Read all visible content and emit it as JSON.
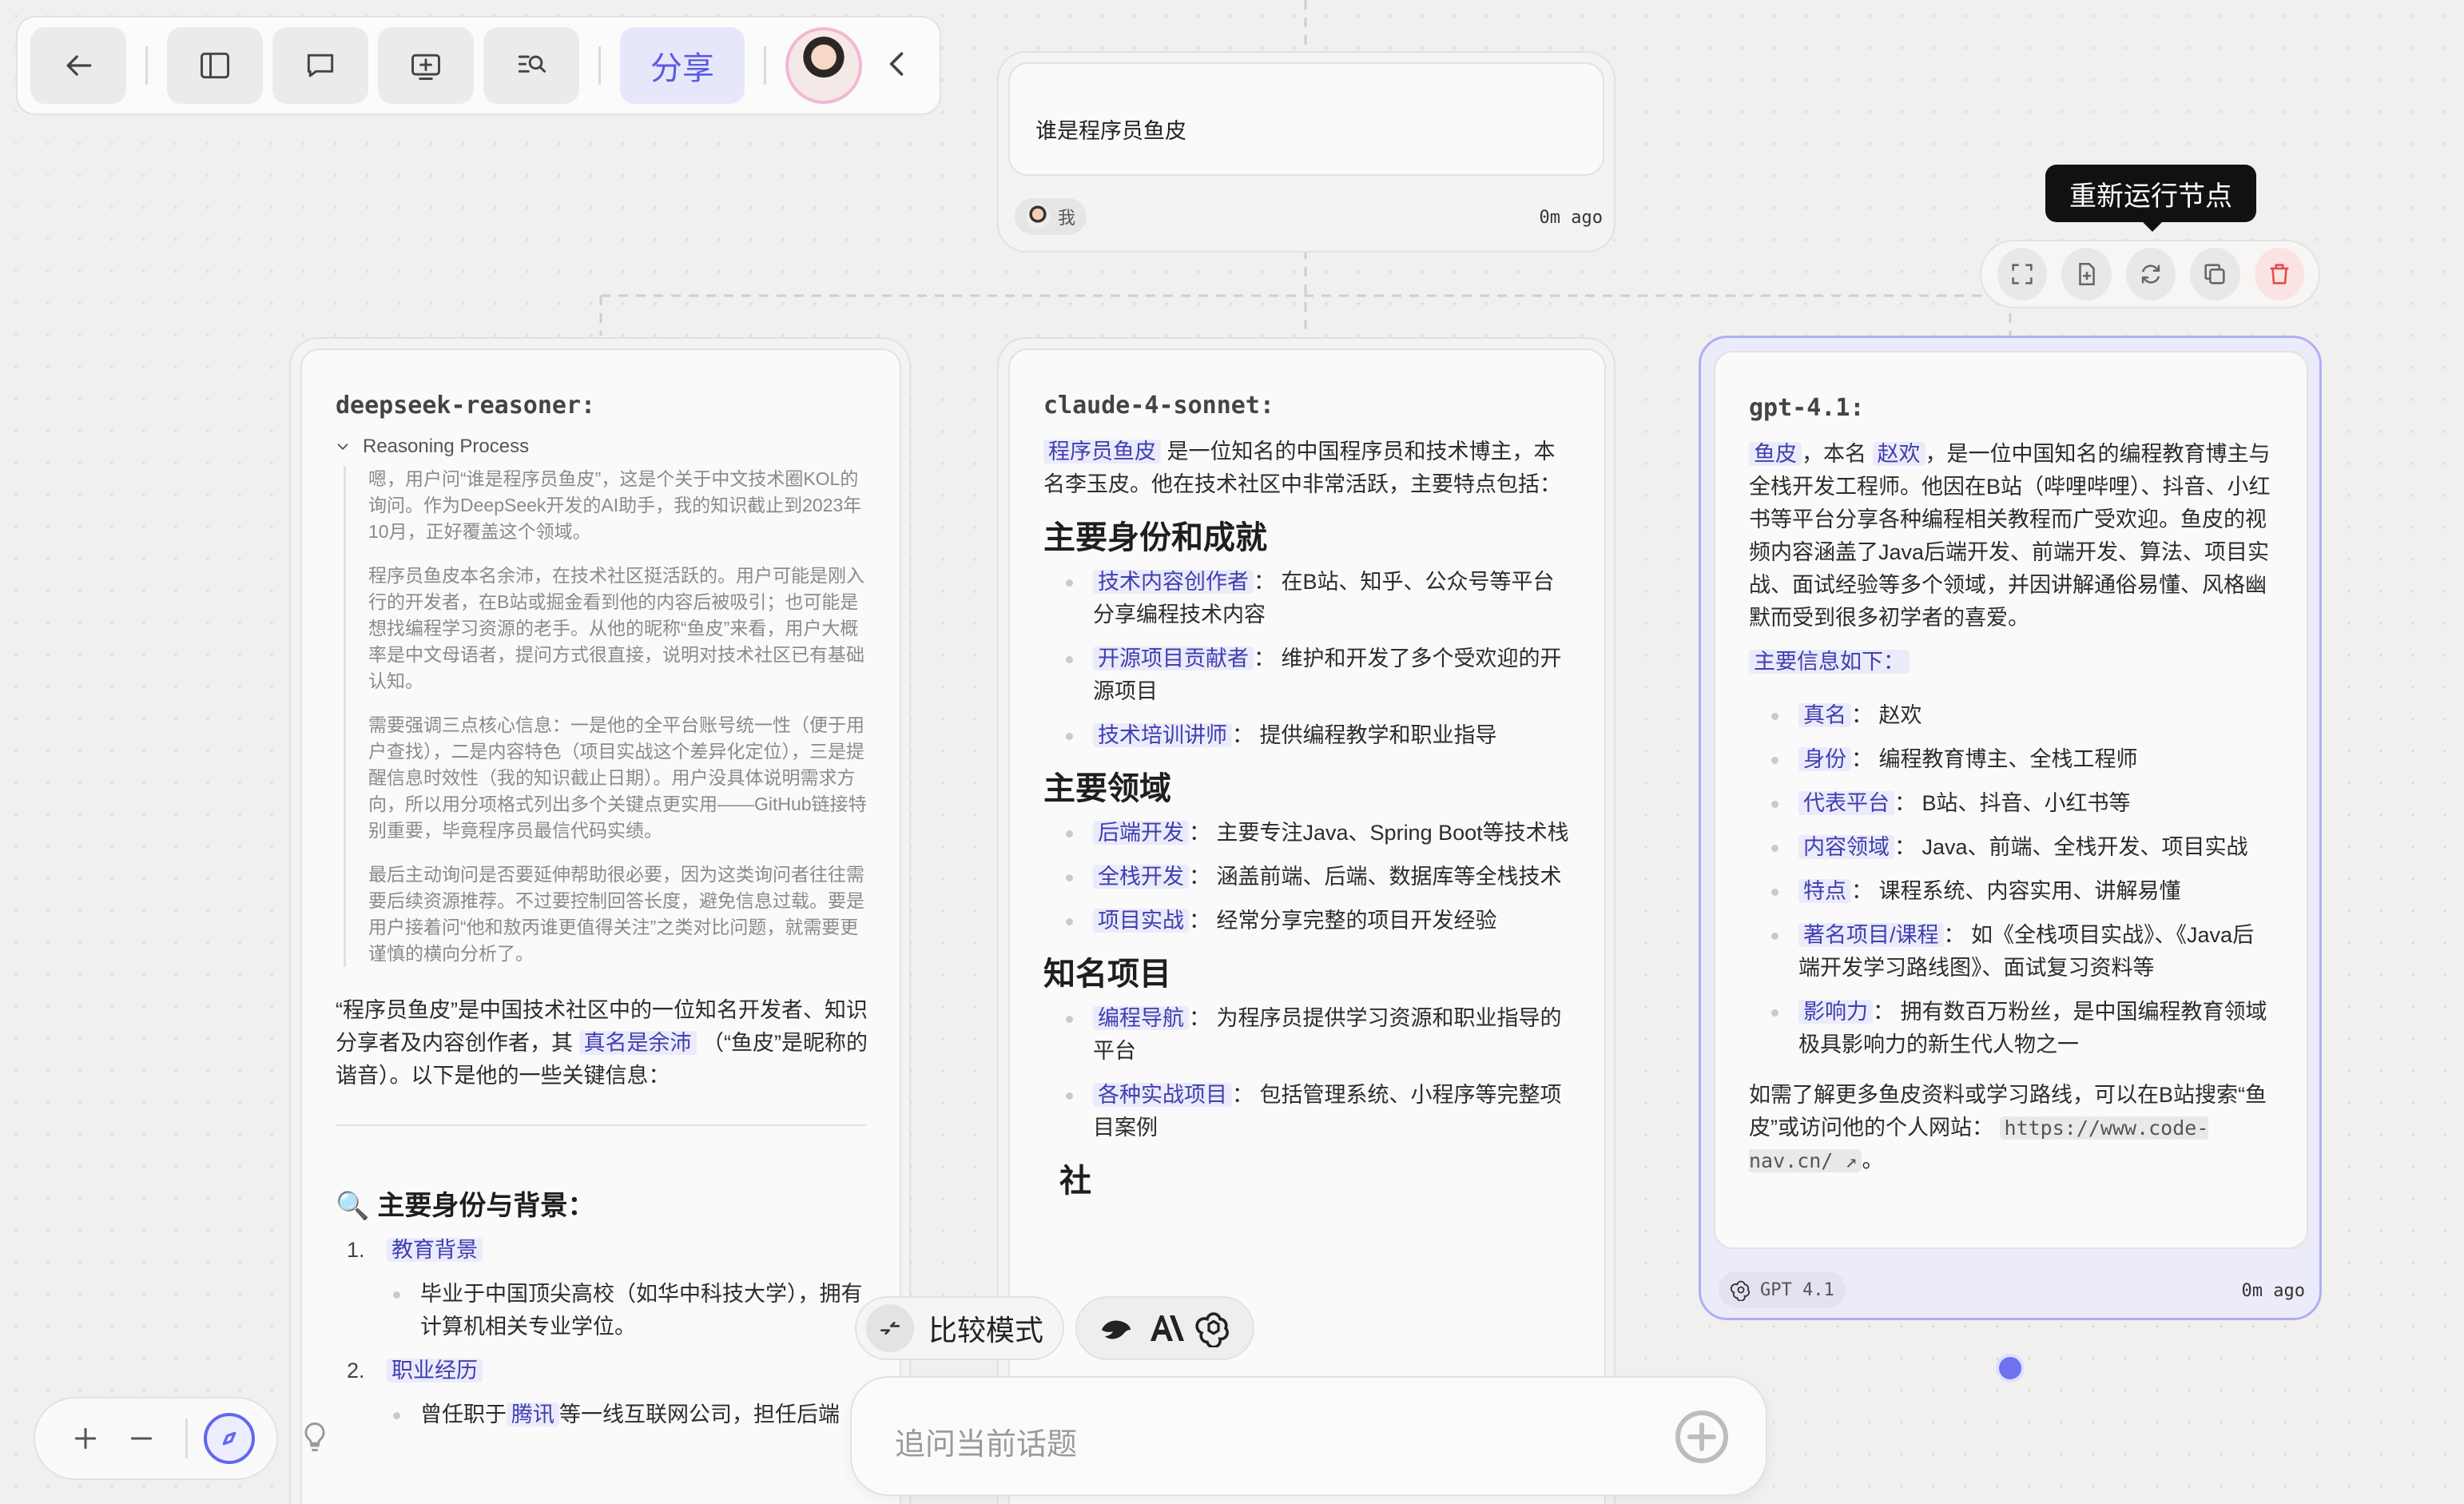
{
  "toolbar": {
    "share_label": "分享"
  },
  "question_node": {
    "text": "谁是程序员鱼皮",
    "author": "我",
    "time": "0m ago"
  },
  "deepseek": {
    "model": "deepseek-reasoner:",
    "reasoning_label": "Reasoning Process",
    "reasoning": [
      "嗯，用户问“谁是程序员鱼皮”，这是个关于中文技术圈KOL的询问。作为DeepSeek开发的AI助手，我的知识截止到2023年10月，正好覆盖这个领域。",
      "程序员鱼皮本名余沛，在技术社区挺活跃的。用户可能是刚入行的开发者，在B站或掘金看到他的内容后被吸引；也可能是想找编程学习资源的老手。从他的昵称“鱼皮”来看，用户大概率是中文母语者，提问方式很直接，说明对技术社区已有基础认知。",
      "需要强调三点核心信息：一是他的全平台账号统一性（便于用户查找），二是内容特色（项目实战这个差异化定位），三是提醒信息时效性（我的知识截止日期）。用户没具体说明需求方向，所以用分项格式列出多个关键点更实用——GitHub链接特别重要，毕竟程序员最信代码实绩。",
      "最后主动询问是否要延伸帮助很必要，因为这类询问者往往需要后续资源推荐。不过要控制回答长度，避免信息过载。要是用户接着问“他和敖丙谁更值得关注”之类对比问题，就需要更谨慎的横向分析了。"
    ],
    "intro_1": "“程序员鱼皮”是中国技术社区中的一位知名开发者、知识分享者及内容创作者，其",
    "intro_hl": "真名是余沛",
    "intro_2": "（“鱼皮”是昵称的谐音）。以下是他的一些关键信息：",
    "section_icon": "🔍",
    "section_title": "主要身份与背景：",
    "items": [
      {
        "num": "1.",
        "label": "教育背景",
        "sub": "毕业于中国顶尖高校（如华中科技大学），拥有计算机相关专业学位。"
      },
      {
        "num": "2.",
        "label": "职业经历",
        "sub_1": "曾任职于",
        "sub_hl": "腾讯",
        "sub_2": "等一线互联网公司，担任后端"
      }
    ]
  },
  "claude": {
    "model": "claude-4-sonnet:",
    "intro_hl": "程序员鱼皮",
    "intro": "是一位知名的中国程序员和技术博主，本名李玉皮。他在技术社区中非常活跃，主要特点包括：",
    "sections": [
      {
        "title": "主要身份和成就",
        "items": [
          {
            "label": "技术内容创作者",
            "text": "在B站、知乎、公众号等平台分享编程技术内容"
          },
          {
            "label": "开源项目贡献者",
            "text": "维护和开发了多个受欢迎的开源项目"
          },
          {
            "label": "技术培训讲师",
            "text": "提供编程教学和职业指导"
          }
        ]
      },
      {
        "title": "主要领域",
        "items": [
          {
            "label": "后端开发",
            "text": "主要专注Java、Spring Boot等技术栈"
          },
          {
            "label": "全栈开发",
            "text": "涵盖前端、后端、数据库等全栈技术"
          },
          {
            "label": "项目实战",
            "text": "经常分享完整的项目开发经验"
          }
        ]
      },
      {
        "title": "知名项目",
        "items": [
          {
            "label": "编程导航",
            "text": "为程序员提供学习资源和职业指导的平台"
          },
          {
            "label": "各种实战项目",
            "text": "包括管理系统、小程序等完整项目案例"
          }
        ]
      }
    ],
    "cut_heading": "社"
  },
  "gpt": {
    "model": "gpt-4.1:",
    "p1_hl1": "鱼皮",
    "p1_a": "，本名",
    "p1_hl2": "赵欢",
    "p1_b": "，是一位中国知名的编程教育博主与全栈开发工程师。他因在B站（哔哩哔哩）、抖音、小红书等平台分享各种编程相关教程而广受欢迎。鱼皮的视频内容涵盖了Java后端开发、前端开发、算法、项目实战、面试经验等多个领域，并因讲解通俗易懂、风格幽默而受到很多初学者的喜爱。",
    "info_label": "主要信息如下：",
    "items": [
      {
        "label": "真名",
        "text": "赵欢"
      },
      {
        "label": "身份",
        "text": "编程教育博主、全栈工程师"
      },
      {
        "label": "代表平台",
        "text": "B站、抖音、小红书等"
      },
      {
        "label": "内容领域",
        "text": "Java、前端、全栈开发、项目实战"
      },
      {
        "label": "特点",
        "text": "课程系统、内容实用、讲解易懂"
      },
      {
        "label": "著名项目/课程",
        "text": "如《全栈项目实战》、《Java后端开发学习路线图》、面试复习资料等"
      },
      {
        "label": "影响力",
        "text": "拥有数百万粉丝，是中国编程教育领域极具影响力的新生代人物之一"
      }
    ],
    "outro": "如需了解更多鱼皮资料或学习路线，可以在B站搜索“鱼皮”或访问他的个人网站：",
    "link": "https://www.code-nav.cn/",
    "outro_end": "。",
    "footer_model": "GPT 4.1",
    "time": "0m ago"
  },
  "node_tools": {
    "tooltip": "重新运行节点"
  },
  "compare": {
    "label": "比较模式"
  },
  "ask": {
    "placeholder": "追问当前话题"
  },
  "colors": {
    "accent": "#6366f1",
    "highlight_bg": "#ebebfb",
    "danger": "#e84a4a"
  }
}
